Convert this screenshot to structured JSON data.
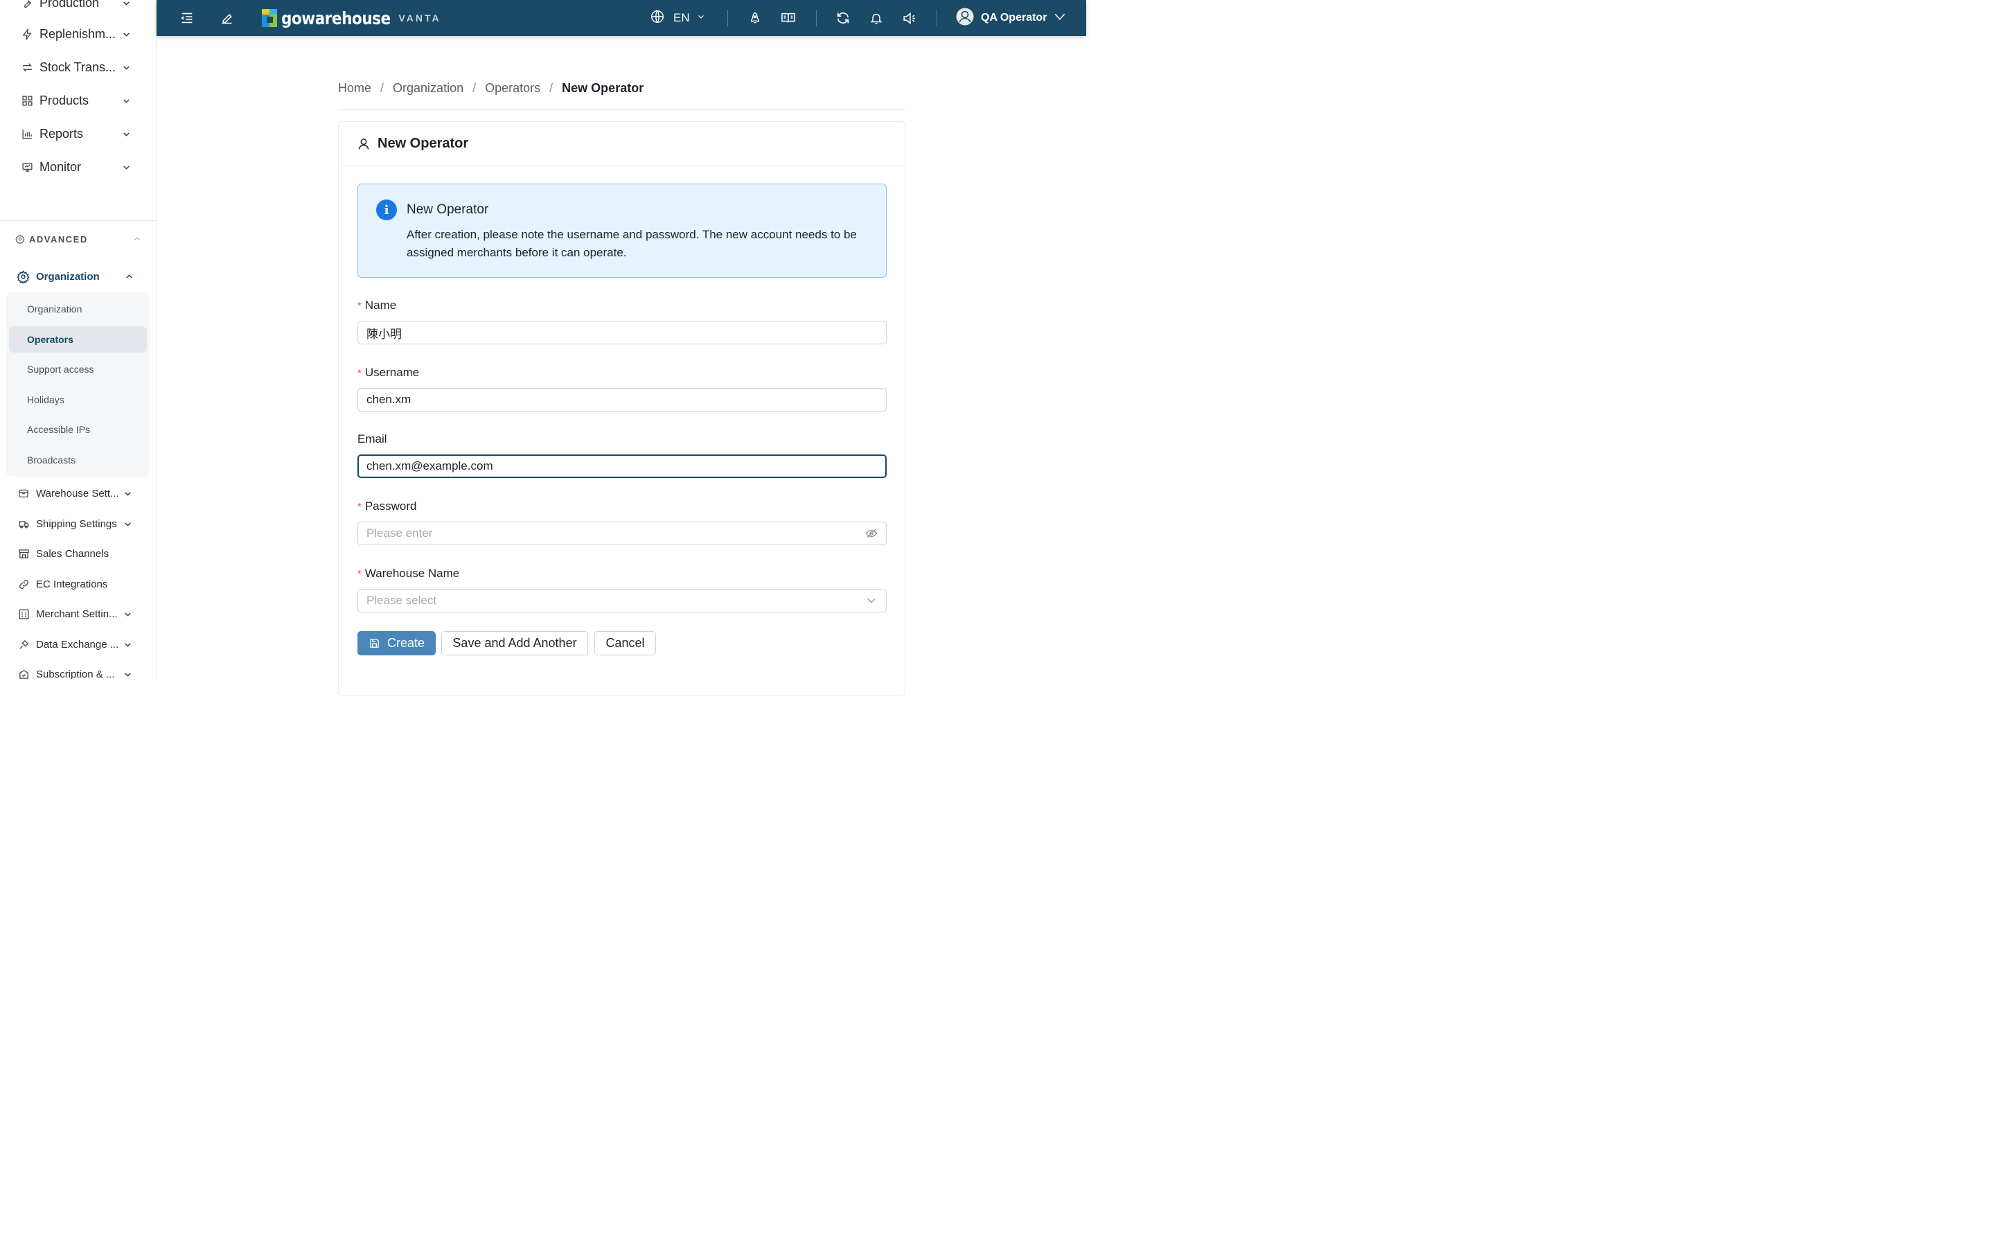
{
  "sidebar": {
    "main_items": [
      {
        "label": "Production",
        "icon": "wrench-icon"
      },
      {
        "label": "Replenishm...",
        "icon": "lightning-icon"
      },
      {
        "label": "Stock Trans...",
        "icon": "transfer-arrows-icon"
      },
      {
        "label": "Products",
        "icon": "grid-icon"
      },
      {
        "label": "Reports",
        "icon": "bar-chart-icon"
      },
      {
        "label": "Monitor",
        "icon": "monitor-icon"
      }
    ],
    "advanced_label": "ADVANCED",
    "organization_label": "Organization",
    "sub_items": [
      {
        "label": "Organization"
      },
      {
        "label": "Operators"
      },
      {
        "label": "Support access"
      },
      {
        "label": "Holidays"
      },
      {
        "label": "Accessible IPs"
      },
      {
        "label": "Broadcasts"
      }
    ],
    "advanced_items": [
      {
        "label": "Warehouse Sett...",
        "icon": "warehouse-icon"
      },
      {
        "label": "Shipping Settings",
        "icon": "truck-icon"
      },
      {
        "label": "Sales Channels",
        "icon": "store-icon"
      },
      {
        "label": "EC Integrations",
        "icon": "link-icon"
      },
      {
        "label": "Merchant Settin...",
        "icon": "merchant-icon"
      },
      {
        "label": "Data Exchange ...",
        "icon": "plug-icon"
      },
      {
        "label": "Subscription & ...",
        "icon": "subscription-icon"
      }
    ]
  },
  "topbar": {
    "logo_text": "gowarehouse",
    "logo_sub": "VANTA",
    "language": "EN",
    "user_name": "QA Operator"
  },
  "breadcrumb": {
    "home": "Home",
    "organization": "Organization",
    "operators": "Operators",
    "current": "New Operator"
  },
  "card": {
    "title": "New Operator"
  },
  "alert": {
    "title": "New Operator",
    "message": "After creation, please note the username and password. The new account needs to be assigned merchants before it can operate."
  },
  "form": {
    "name_label": "Name",
    "name_value": "陳小明",
    "username_label": "Username",
    "username_value": "chen.xm",
    "email_label": "Email",
    "email_value": "chen.xm@example.com",
    "password_label": "Password",
    "password_placeholder": "Please enter",
    "warehouse_label": "Warehouse Name",
    "warehouse_placeholder": "Please select"
  },
  "actions": {
    "create": "Create",
    "save_add_another": "Save and Add Another",
    "cancel": "Cancel"
  },
  "colors": {
    "topbar": "#1a4a66",
    "primary_button": "#4a86ba",
    "alert_bg": "#e6f2fc",
    "required": "#e5484d"
  }
}
